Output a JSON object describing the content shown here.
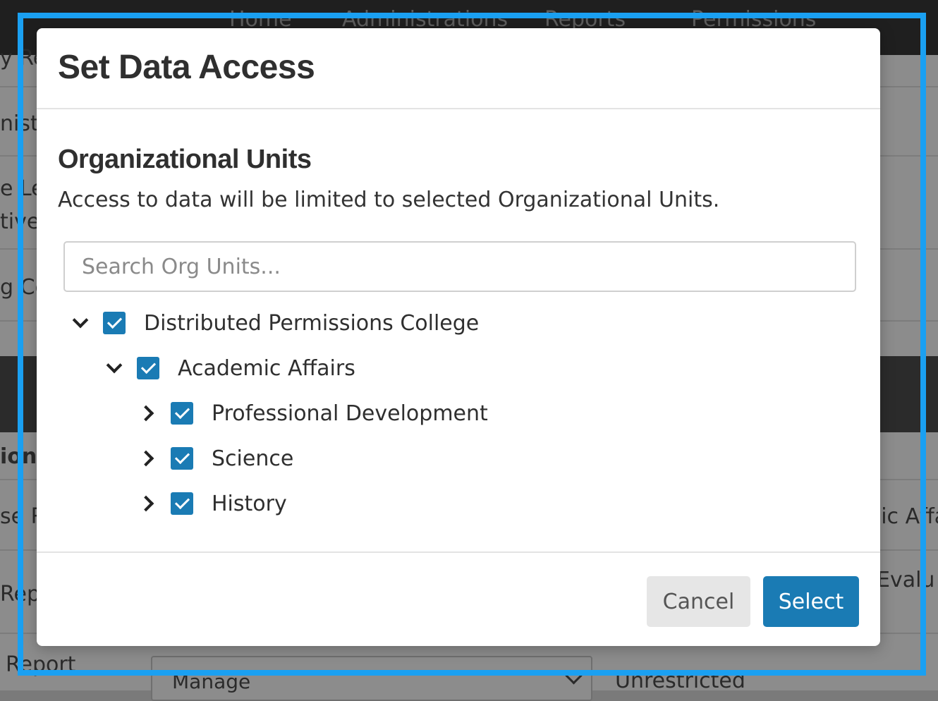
{
  "background": {
    "nav": [
      "Home",
      "Administrations",
      "Reports",
      "Permissions"
    ],
    "fragments": {
      "row1": "y Re",
      "row2": "nistr",
      "row3a": "e Le",
      "row3b": "tives",
      "row4": "g Ce",
      "section": "ions",
      "row5": "se R",
      "row5_right": "mic Affa",
      "row6": "Rep",
      "row6_right": "e Evalu",
      "row7": "Report"
    },
    "select_value": "Manage",
    "right_value": "Unrestricted"
  },
  "modal": {
    "title": "Set Data Access",
    "section_title": "Organizational Units",
    "description": "Access to data will be limited to selected Organizational Units.",
    "search_placeholder": "Search Org Units...",
    "tree": [
      {
        "label": "Distributed Permissions College",
        "expanded": true,
        "checked": true,
        "level": 0
      },
      {
        "label": "Academic Affairs",
        "expanded": true,
        "checked": true,
        "level": 1
      },
      {
        "label": "Professional Development",
        "expanded": false,
        "checked": true,
        "level": 2
      },
      {
        "label": "Science",
        "expanded": false,
        "checked": true,
        "level": 2
      },
      {
        "label": "History",
        "expanded": false,
        "checked": true,
        "level": 2
      }
    ],
    "cancel_label": "Cancel",
    "select_label": "Select"
  },
  "colors": {
    "primary": "#1a7bb4",
    "focus_frame": "#1aa0f2"
  }
}
